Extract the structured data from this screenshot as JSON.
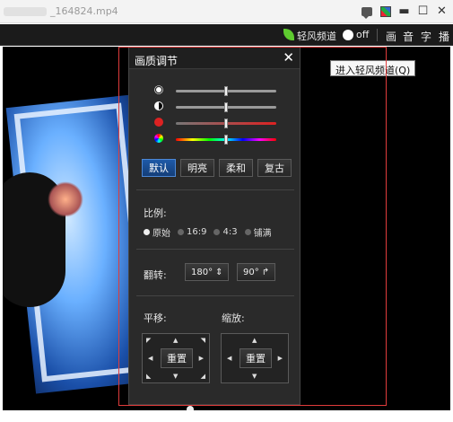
{
  "window": {
    "title_suffix": "_164824.mp4",
    "buttons": [
      "msg-icon",
      "skin-icon",
      "minimize-icon",
      "maximize-icon",
      "close-icon"
    ]
  },
  "toolbar": {
    "channel_label": "轻风频道",
    "toggle_state": "off",
    "items": [
      "画",
      "音",
      "字",
      "播"
    ]
  },
  "tooltip": {
    "text": "进入轻风频道(Q)"
  },
  "panel": {
    "title": "画质调节",
    "close": "✕",
    "sliders": [
      {
        "name": "brightness",
        "icon": "sun-icon",
        "value": 0.5
      },
      {
        "name": "contrast",
        "icon": "contrast-icon",
        "value": 0.5
      },
      {
        "name": "saturation",
        "icon": "saturation-icon",
        "value": 0.5
      },
      {
        "name": "hue",
        "icon": "hue-icon",
        "value": 0.5
      }
    ],
    "presets": [
      {
        "label": "默认",
        "active": true
      },
      {
        "label": "明亮",
        "active": false
      },
      {
        "label": "柔和",
        "active": false
      },
      {
        "label": "复古",
        "active": false
      }
    ],
    "ratio_label": "比例:",
    "ratios": [
      {
        "label": "原始",
        "selected": true
      },
      {
        "label": "16:9",
        "selected": false
      },
      {
        "label": "4:3",
        "selected": false
      },
      {
        "label": "铺满",
        "selected": false
      }
    ],
    "rotate_label": "翻转:",
    "rotate_buttons": [
      {
        "label": "180°",
        "icon": "flip-vertical-icon"
      },
      {
        "label": "90°",
        "icon": "rotate-right-icon"
      }
    ],
    "pan_label": "平移:",
    "zoom_label": "缩放:",
    "pan_reset": "重置",
    "zoom_reset": "重置"
  }
}
